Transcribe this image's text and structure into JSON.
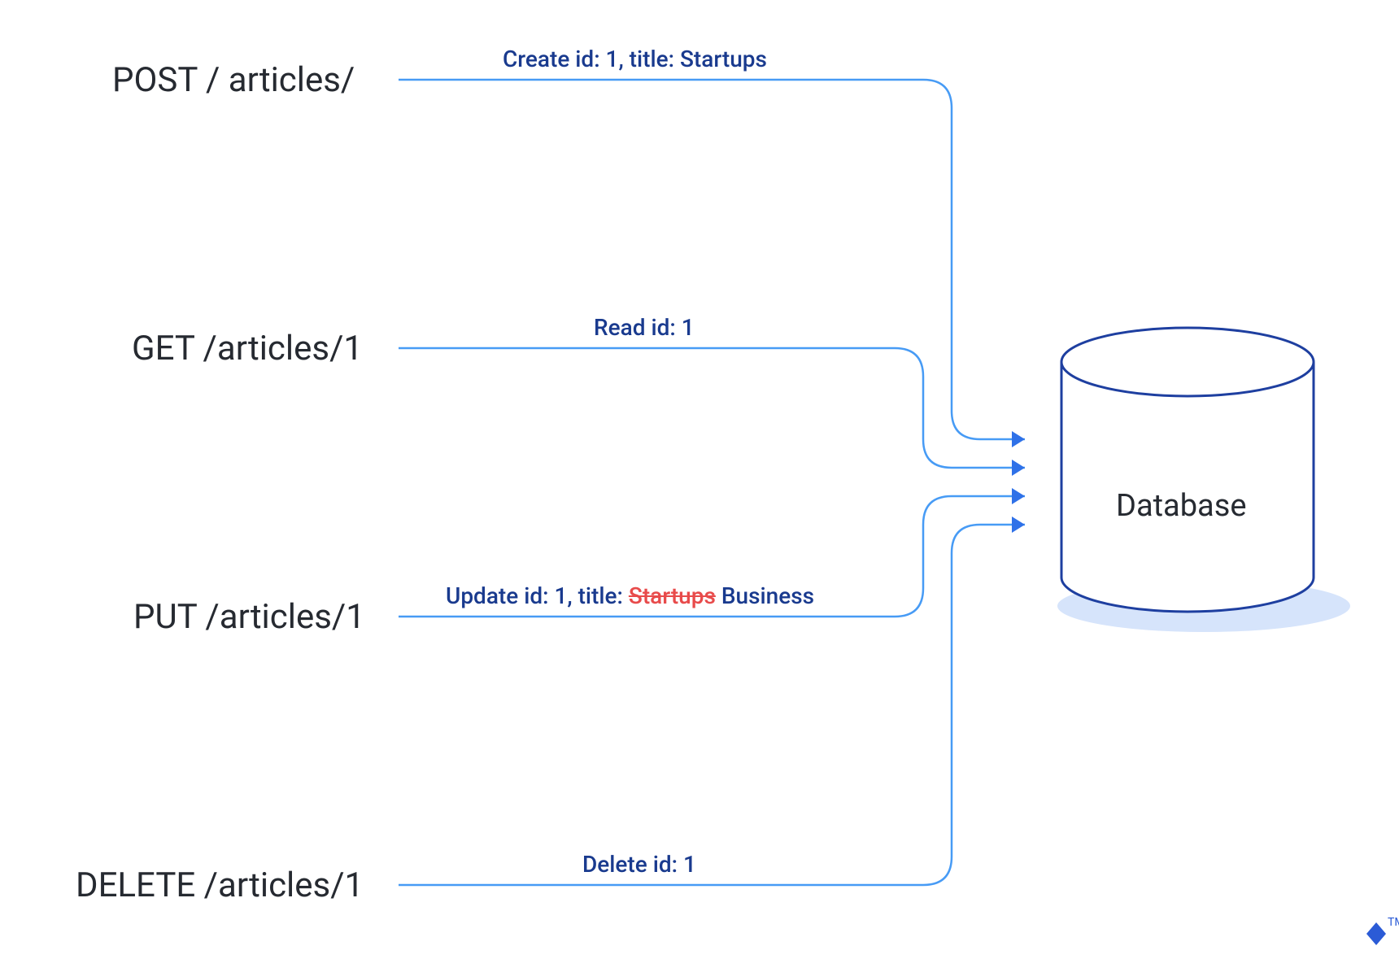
{
  "methods": {
    "post": {
      "label": "POST / articles/",
      "action": "Create id: 1, title: Startups"
    },
    "get": {
      "label": "GET /articles/1",
      "action": "Read id: 1"
    },
    "put": {
      "label": "PUT /articles/1",
      "action_prefix": "Update id: 1, title: ",
      "action_strike": "Startups",
      "action_suffix": " Business"
    },
    "delete": {
      "label": "DELETE /articles/1",
      "action": "Delete id: 1"
    }
  },
  "database": {
    "label": "Database"
  },
  "logo": {
    "tm": "TM"
  },
  "colors": {
    "line": "#3b82f6",
    "text_dark": "#262a31",
    "text_blue": "#193a8e",
    "text_red": "#e84b4b",
    "db_stroke": "#1e3fa0",
    "shadow": "#d6e4fb"
  }
}
